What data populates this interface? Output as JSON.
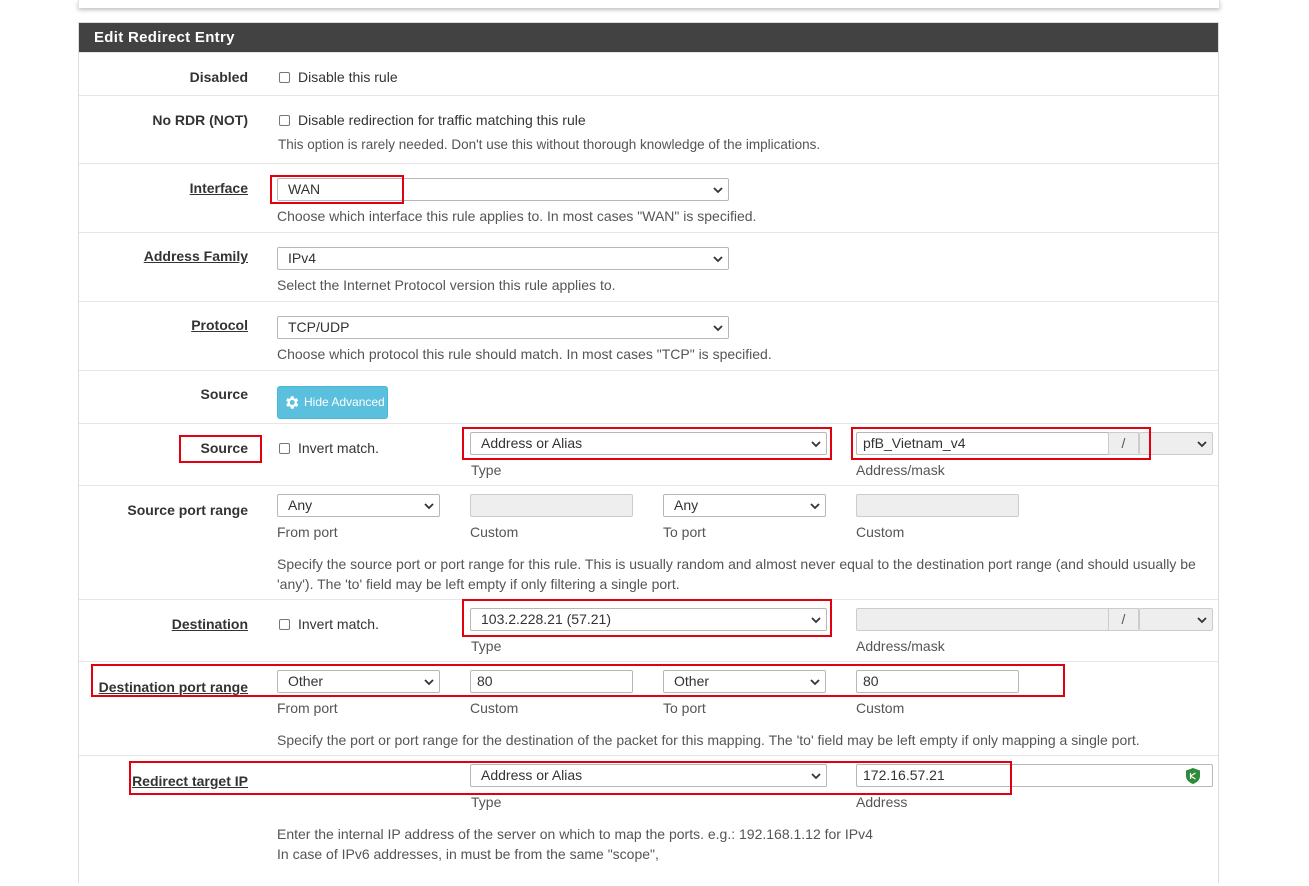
{
  "panel": {
    "title": "Edit Redirect Entry"
  },
  "disabled": {
    "label": "Disabled",
    "checkbox_label": "Disable this rule"
  },
  "nordr": {
    "label": "No RDR (NOT)",
    "checkbox_label": "Disable redirection for traffic matching this rule",
    "help": "This option is rarely needed. Don't use this without thorough knowledge of the implications."
  },
  "interface": {
    "label": "Interface",
    "value": "WAN",
    "help": "Choose which interface this rule applies to. In most cases \"WAN\" is specified."
  },
  "address_family": {
    "label": "Address Family",
    "value": "IPv4",
    "help": "Select the Internet Protocol version this rule applies to."
  },
  "protocol": {
    "label": "Protocol",
    "value": "TCP/UDP",
    "help": "Choose which protocol this rule should match. In most cases \"TCP\" is specified."
  },
  "source_adv": {
    "label": "Source",
    "button": "Hide Advanced"
  },
  "source": {
    "label": "Source",
    "invert_label": "Invert match.",
    "type_value": "Address or Alias",
    "type_caption": "Type",
    "address_value": "pfB_Vietnam_v4",
    "slash": "/",
    "address_caption": "Address/mask"
  },
  "source_port": {
    "label": "Source port range",
    "from_value": "Any",
    "from_caption": "From port",
    "custom_caption": "Custom",
    "to_value": "Any",
    "to_caption": "To port",
    "custom2_caption": "Custom",
    "help_line1": "Specify the source port or port range for this rule. This is usually random and almost never equal to the destination port range (and should usually be",
    "help_line2": "'any'). The 'to' field may be left empty if only filtering a single port."
  },
  "destination": {
    "label": "Destination",
    "invert_label": "Invert match.",
    "type_value": "103.2.228.21 (57.21)",
    "type_caption": "Type",
    "slash": "/",
    "address_caption": "Address/mask"
  },
  "dest_port": {
    "label": "Destination port range",
    "from_value": "Other",
    "from_caption": "From port",
    "custom_value": "80",
    "custom_caption": "Custom",
    "to_value": "Other",
    "to_caption": "To port",
    "custom2_value": "80",
    "custom2_caption": "Custom",
    "help": "Specify the port or port range for the destination of the packet for this mapping. The 'to' field may be left empty if only mapping a single port."
  },
  "redirect": {
    "label": "Redirect target IP",
    "type_value": "Address or Alias",
    "type_caption": "Type",
    "address_value": "172.16.57.21",
    "address_caption": "Address",
    "help_line1": "Enter the internal IP address of the server on which to map the ports. e.g.: 192.168.1.12 for IPv4",
    "help_line2": "In case of IPv6 addresses, in must be from the same \"scope\","
  },
  "colors": {
    "header_bg": "#424242",
    "info_button": "#5bc0de",
    "highlight": "#e0000e",
    "shield": "#2e8b3a"
  }
}
